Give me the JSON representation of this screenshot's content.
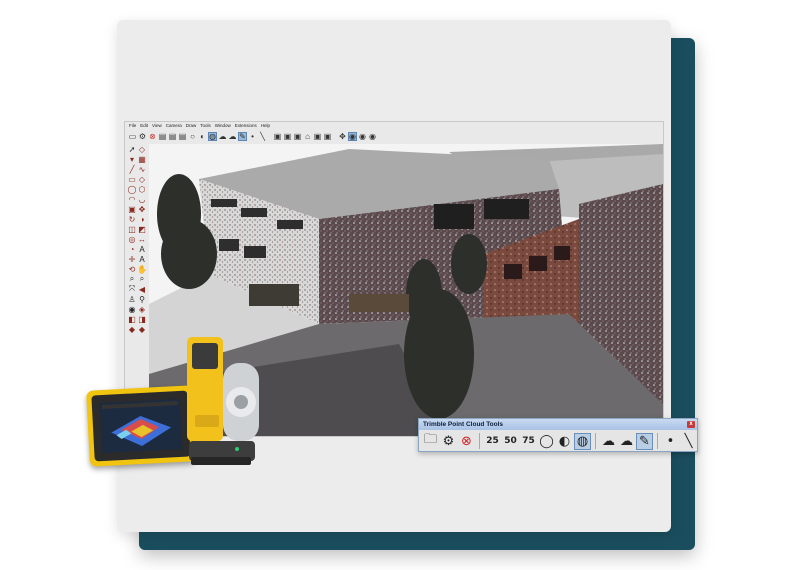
{
  "app": {
    "menus": [
      "File",
      "Edit",
      "View",
      "Camera",
      "Draw",
      "Tools",
      "Window",
      "Extensions",
      "Help"
    ]
  },
  "point_cloud_toolbar": {
    "title": "Trimble Point Cloud Tools",
    "close_glyph": "x",
    "tools": [
      {
        "name": "open-folder-icon",
        "glyph": "🗀"
      },
      {
        "name": "gear-icon",
        "glyph": "⚙"
      },
      {
        "name": "cancel-circle-icon",
        "glyph": "⊗"
      },
      {
        "name": "density-25-icon",
        "glyph": "25"
      },
      {
        "name": "density-50-icon",
        "glyph": "50"
      },
      {
        "name": "density-75-icon",
        "glyph": "75"
      },
      {
        "name": "drop-icon",
        "glyph": "◯"
      },
      {
        "name": "half-drop-icon",
        "glyph": "◐"
      },
      {
        "name": "striped-drop-icon",
        "glyph": "◍"
      },
      {
        "name": "cloud-upload-icon",
        "glyph": "☁"
      },
      {
        "name": "cloud-download-icon",
        "glyph": "☁"
      },
      {
        "name": "paint-icon",
        "glyph": "✎"
      },
      {
        "name": "point-icon",
        "glyph": "•"
      },
      {
        "name": "line-icon",
        "glyph": "╲"
      }
    ]
  },
  "colors": {
    "teal_card": "#1a4e5e",
    "device_yellow": "#f1c40f",
    "close_red": "#c43b3b"
  }
}
